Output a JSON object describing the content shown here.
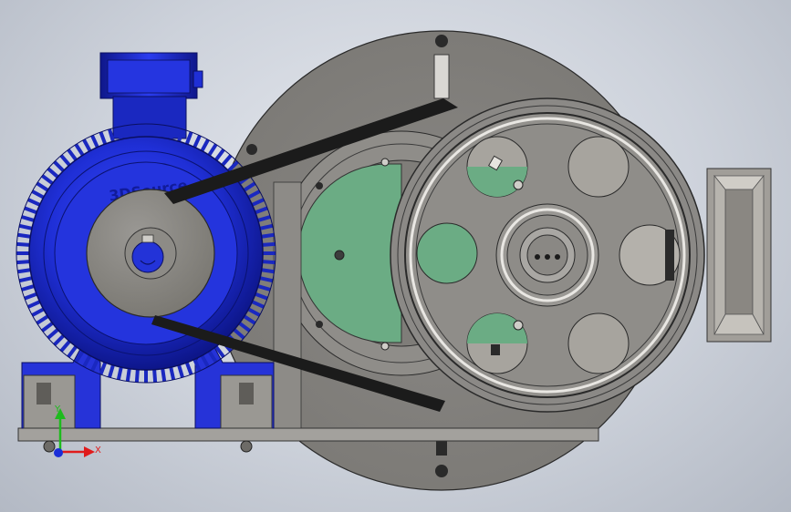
{
  "viewport": {
    "watermark": "3DSource",
    "background_top": "#e6e9ef",
    "background_bottom": "#b3b9c4"
  },
  "colors": {
    "motor_blue": "#1f2fd6",
    "motor_blue_dark": "#0f178a",
    "steel_gray": "#8a8885",
    "steel_light": "#a9a7a3",
    "steel_dark": "#5f5d5a",
    "green_part": "#6bac84",
    "belt": "#1b1b1b",
    "hopper": "#bdbab4"
  },
  "triad": {
    "x_label": "X",
    "y_label": "Y",
    "x_color": "#e01b1b",
    "y_color": "#1dbb1d",
    "z_color": "#1b2ed8"
  },
  "parts": [
    {
      "name": "motor",
      "icon": "motor-icon"
    },
    {
      "name": "drive-pulley",
      "icon": "pulley-icon"
    },
    {
      "name": "large-flywheel-pulley",
      "icon": "pulley-icon"
    },
    {
      "name": "v-belt",
      "icon": "belt-icon"
    },
    {
      "name": "crusher-housing",
      "icon": "housing-icon"
    },
    {
      "name": "base-frame",
      "icon": "frame-icon"
    },
    {
      "name": "hopper",
      "icon": "hopper-icon"
    }
  ]
}
